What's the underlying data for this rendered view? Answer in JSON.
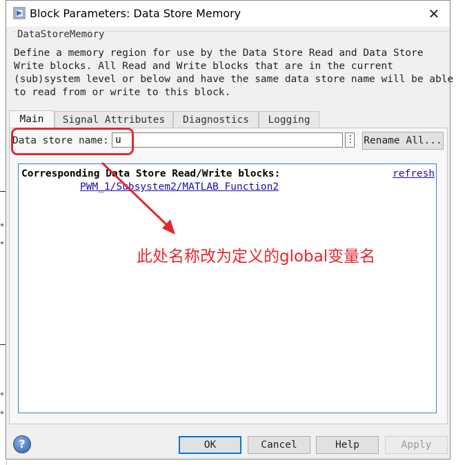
{
  "window": {
    "title": "Block Parameters: Data Store Memory",
    "close_glyph": "✕"
  },
  "block": {
    "type": "DataStoreMemory",
    "description": "Define a memory region for use by the Data Store Read and Data Store\nWrite blocks. All Read and Write blocks that are in the current\n(sub)system level or below and have the same data store name will be able\nto read from or write to this block."
  },
  "tabs": [
    {
      "label": "Main",
      "active": true
    },
    {
      "label": "Signal Attributes",
      "active": false
    },
    {
      "label": "Diagnostics",
      "active": false
    },
    {
      "label": "Logging",
      "active": false
    }
  ],
  "main": {
    "data_store_name_label": "Data store name:",
    "data_store_name_value": "u",
    "more_glyph": "⋮",
    "rename_all_label": "Rename All..."
  },
  "blocks_list": {
    "heading": "Corresponding Data Store Read/Write blocks:",
    "refresh_label": "refresh",
    "links": [
      "PWM_1/Subsystem2/MATLAB Function2"
    ]
  },
  "annotation": {
    "text": "此处名称改为定义的global变量名",
    "color": "#e8262a"
  },
  "footer": {
    "help_glyph": "?",
    "ok_label": "OK",
    "cancel_label": "Cancel",
    "help_label": "Help",
    "apply_label": "Apply",
    "apply_enabled": false
  },
  "colors": {
    "accent": "#0078d7",
    "link": "#1a0dab",
    "annotation_red": "#e8262a"
  }
}
